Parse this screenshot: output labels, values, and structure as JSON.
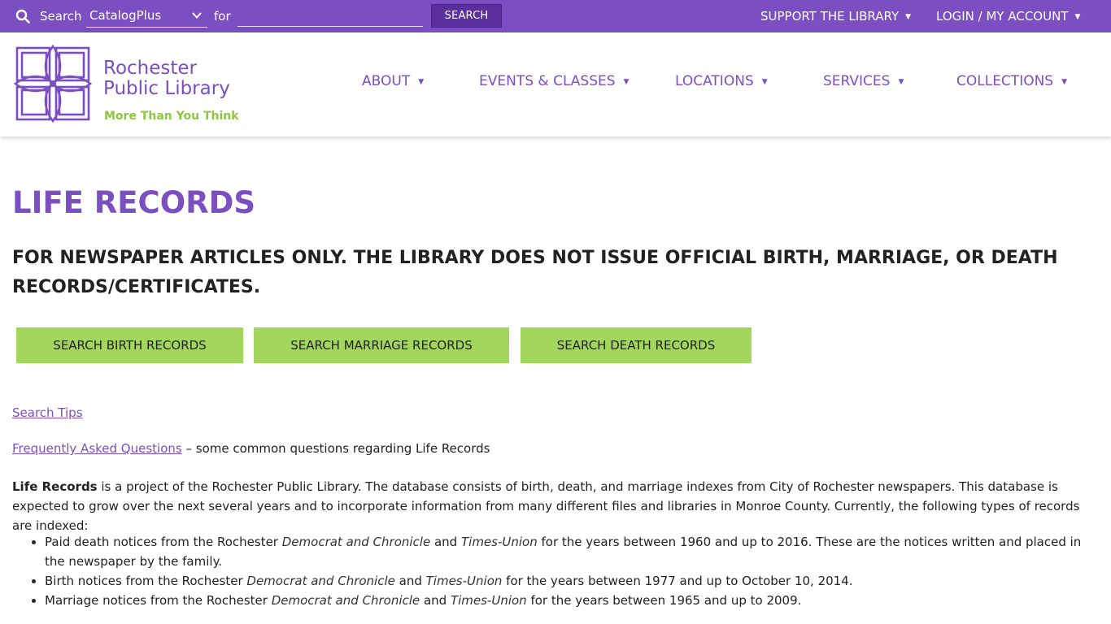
{
  "topbar": {
    "search_label": "Search",
    "catalog_value": "CatalogPlus",
    "for_label": "for",
    "search_input_value": "",
    "search_button": "SEARCH",
    "support_link": "SUPPORT THE LIBRARY",
    "login_link": "LOGIN / MY ACCOUNT",
    "bar_color": "#7b4fc2"
  },
  "logo": {
    "line1": "Rochester",
    "line2": "Public Library",
    "tagline": "More Than You Think",
    "brand_color": "#7b4fc2",
    "tagline_color": "#8cc63f"
  },
  "nav": {
    "items": [
      {
        "label": "ABOUT"
      },
      {
        "label": "EVENTS & CLASSES"
      },
      {
        "label": "LOCATIONS"
      },
      {
        "label": "SERVICES"
      },
      {
        "label": "COLLECTIONS"
      }
    ]
  },
  "main": {
    "title": "LIFE RECORDS",
    "subtitle": "FOR NEWSPAPER ARTICLES ONLY. THE LIBRARY DOES NOT ISSUE OFFICIAL BIRTH, MARRIAGE, OR DEATH RECORDS/CERTIFICATES.",
    "buttons": {
      "birth": "SEARCH BIRTH RECORDS",
      "marriage": "SEARCH MARRIAGE RECORDS",
      "death": "SEARCH DEATH RECORDS",
      "color": "#a2d65c"
    },
    "search_tips": "Search Tips",
    "faq_link": "Frequently Asked Questions",
    "faq_suffix": " – some common questions regarding Life Records",
    "intro_bold": "Life Records",
    "intro_rest": " is a project of the Rochester Public Library. The database consists of birth, death, and marriage indexes from City of Rochester newspapers. This database is expected to grow over the next several years and to incorporate information from many different files and libraries in Monroe County. Currently, the following types of records are indexed:",
    "bullets": [
      {
        "a": "Paid death notices from the Rochester ",
        "paper1": "Democrat and Chronicle",
        "and": " and ",
        "paper2": "Times-Union",
        "b": " for the years between 1960 and up to 2016. These are the notices written and placed in the newspaper by the family."
      },
      {
        "a": "Birth notices from the Rochester ",
        "paper1": "Democrat and Chronicle",
        "and": " and ",
        "paper2": "Times-Union",
        "b": " for the years between 1977 and up to October 10, 2014."
      },
      {
        "a": "Marriage notices from the Rochester ",
        "paper1": "Democrat and Chronicle",
        "and": " and ",
        "paper2": "Times-Union",
        "b": " for the years between 1965 and up to 2009."
      }
    ]
  }
}
